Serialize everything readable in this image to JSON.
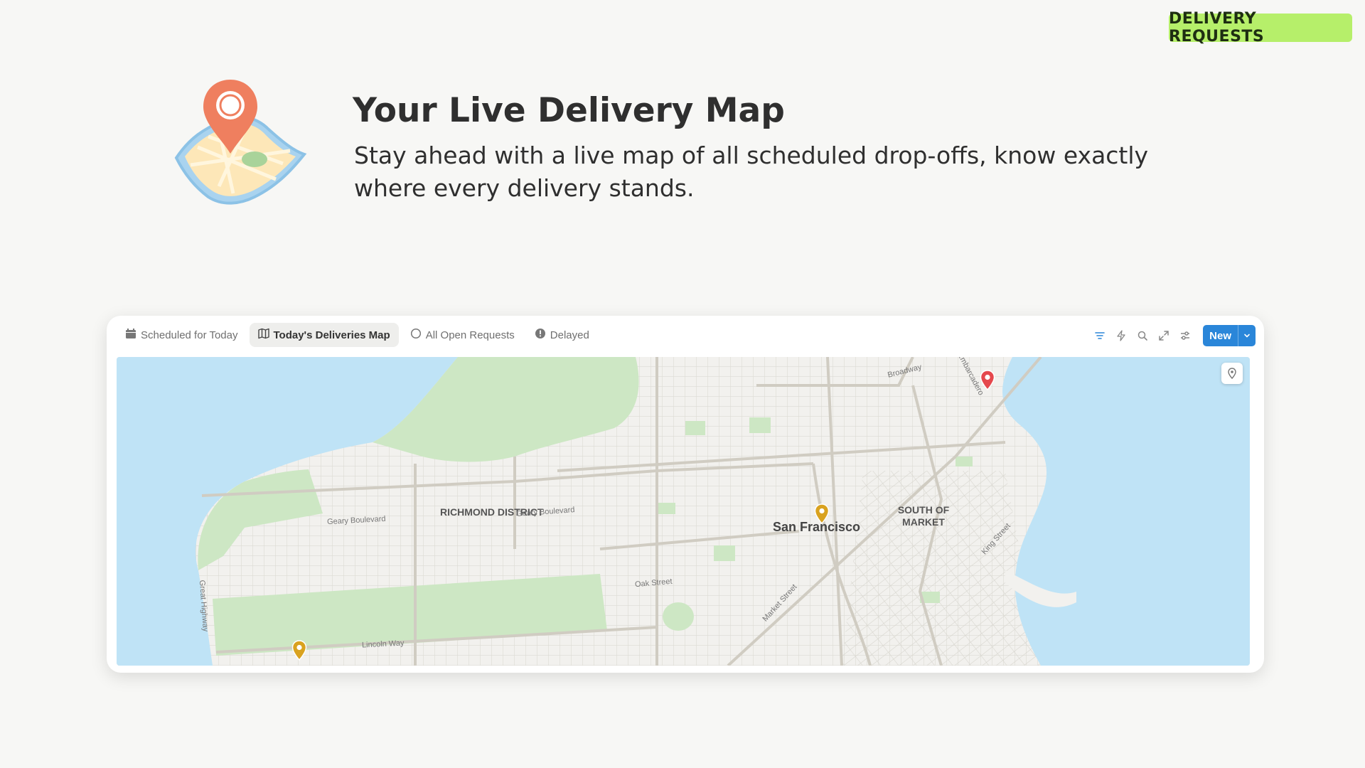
{
  "badge": "DELIVERY REQUESTS",
  "hero": {
    "icon": "map-pin-icon",
    "title": "Your Live Delivery Map",
    "subtitle": "Stay ahead with a live map of all scheduled drop-offs, know exactly where every delivery stands."
  },
  "view_tabs": [
    {
      "label": "Scheduled for Today",
      "icon": "calendar-icon"
    },
    {
      "label": "Today's Deliveries Map",
      "icon": "map-icon",
      "active": true
    },
    {
      "label": "All Open Requests",
      "icon": "circle-icon"
    },
    {
      "label": "Delayed",
      "icon": "alert-icon"
    }
  ],
  "toolbar": {
    "icons": [
      "filter-icon",
      "lightning-icon",
      "search-icon",
      "expand-icon",
      "settings-icon"
    ],
    "new_label": "New"
  },
  "map": {
    "districts": [
      "RICHMOND DISTRICT",
      "SOUTH OF MARKET"
    ],
    "city": "San Francisco",
    "streets": [
      "Broadway",
      "Embarcadero",
      "Geary Boulevard",
      "Geary Boulevard",
      "Oak Street",
      "Market Street",
      "King Street",
      "Lincoln Way",
      "Great Highway"
    ],
    "pins": [
      {
        "color": "#d9a21f"
      },
      {
        "color": "#d9a21f"
      },
      {
        "color": "#e5484d"
      }
    ]
  },
  "colors": {
    "accent": "#2a86d9",
    "badge": "#b6ef6a",
    "water": "#bfe3f6",
    "park": "#cde7c4",
    "pin_yellow": "#d9a21f",
    "pin_red": "#e5484d"
  }
}
